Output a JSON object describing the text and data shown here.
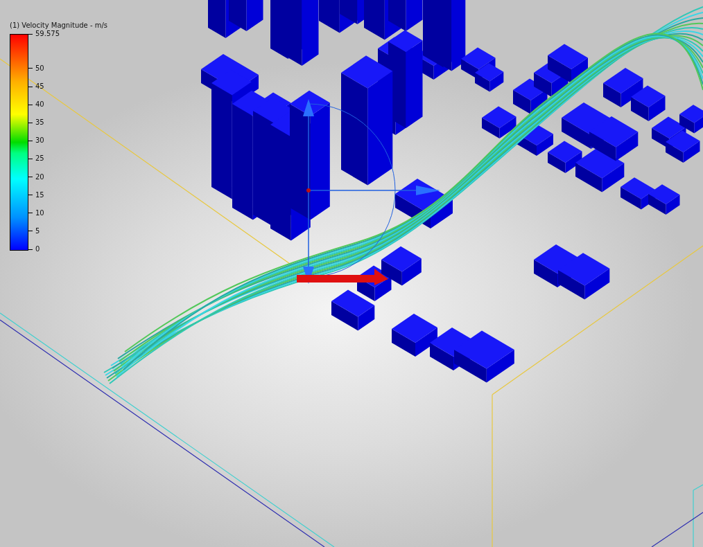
{
  "legend": {
    "title": "(1) Velocity Magnitude - m/s",
    "max_label": "59.575",
    "ticks": [
      "50",
      "45",
      "40",
      "35",
      "30",
      "25",
      "20",
      "15",
      "10",
      "5",
      "0"
    ]
  }
}
